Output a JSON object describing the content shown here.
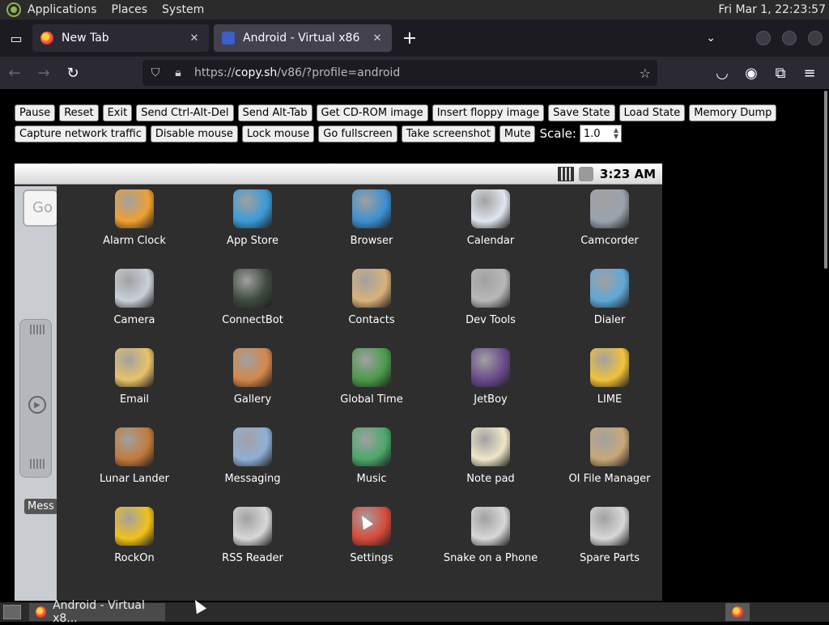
{
  "top_panel": {
    "menus": [
      "Applications",
      "Places",
      "System"
    ],
    "clock": "Fri Mar  1, 22:23:57"
  },
  "tabs": [
    {
      "title": "New Tab",
      "close": "✕"
    },
    {
      "title": "Android - Virtual x86",
      "close": "✕"
    }
  ],
  "new_tab_symbol": "+",
  "url": {
    "prefix": "https://",
    "host": "copy.sh",
    "path": "/v86/?profile=android"
  },
  "controls": {
    "row1": [
      "Pause",
      "Reset",
      "Exit",
      "Send Ctrl-Alt-Del",
      "Send Alt-Tab",
      "Get CD-ROM image",
      "Insert floppy image",
      "Save State",
      "Load State",
      "Memory Dump"
    ],
    "row2": [
      "Capture network traffic",
      "Disable mouse",
      "Lock mouse",
      "Go fullscreen",
      "Take screenshot",
      "Mute"
    ],
    "scale_label": "Scale:",
    "scale_value": "1.0"
  },
  "android": {
    "time": "3:23 AM",
    "search_peek": "Go",
    "mess_peek": "Mess",
    "apps": [
      {
        "label": "Alarm Clock",
        "color": "#f0a030"
      },
      {
        "label": "App Store",
        "color": "#3a9bd8"
      },
      {
        "label": "Browser",
        "color": "#3c8fd0"
      },
      {
        "label": "Calendar",
        "color": "#dfe6ef"
      },
      {
        "label": "Camcorder",
        "color": "#9aa3ad"
      },
      {
        "label": "Camera",
        "color": "#c9d0d8"
      },
      {
        "label": "ConnectBot",
        "color": "#3e4a3e"
      },
      {
        "label": "Contacts",
        "color": "#d9b27a"
      },
      {
        "label": "Dev Tools",
        "color": "#b8b8b8"
      },
      {
        "label": "Dialer",
        "color": "#5fa8d8"
      },
      {
        "label": "Email",
        "color": "#e8c26a"
      },
      {
        "label": "Gallery",
        "color": "#d4874a"
      },
      {
        "label": "Global Time",
        "color": "#4a9a4a"
      },
      {
        "label": "JetBoy",
        "color": "#6a4a8a"
      },
      {
        "label": "LIME",
        "color": "#f2c23a"
      },
      {
        "label": "Lunar Lander",
        "color": "#c27a3a"
      },
      {
        "label": "Messaging",
        "color": "#8fb0d6"
      },
      {
        "label": "Music",
        "color": "#4aa86a"
      },
      {
        "label": "Note pad",
        "color": "#f0e6c8"
      },
      {
        "label": "OI File Manager",
        "color": "#c8a878"
      },
      {
        "label": "RockOn",
        "color": "#f2c21a"
      },
      {
        "label": "RSS Reader",
        "color": "#d8d8d8"
      },
      {
        "label": "Settings",
        "color": "#d84a3a"
      },
      {
        "label": "Snake on a Phone",
        "color": "#d8d8d8"
      },
      {
        "label": "Spare Parts",
        "color": "#d8d8d8"
      }
    ]
  },
  "taskbar": {
    "item": "Android - Virtual x8..."
  }
}
